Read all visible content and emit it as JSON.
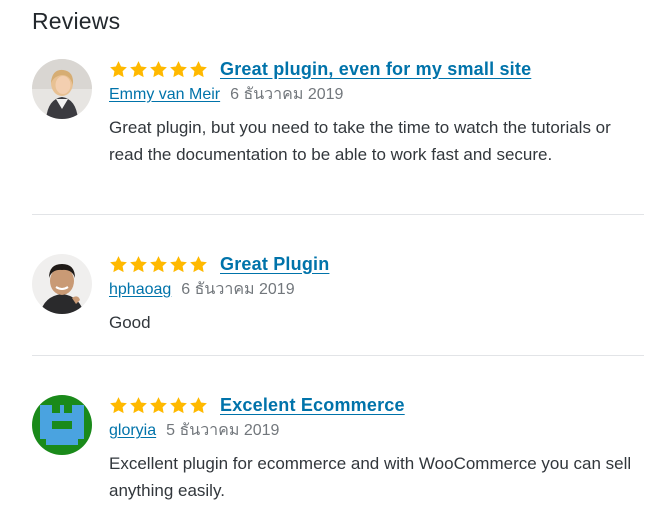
{
  "heading": "Reviews",
  "colors": {
    "link": "#0073aa",
    "star": "#ffb900",
    "date": "#72777c",
    "divider": "#e2e4e7"
  },
  "reviews": [
    {
      "title": "Great plugin, even for my small site",
      "rating": 5,
      "author": "Emmy van Meir",
      "date": "6 ธันวาคม 2019",
      "text": "Great plugin, but you need to take the time to watch the tutorials or read the documentation to be able to work fast and secure."
    },
    {
      "title": "Great Plugin",
      "rating": 5,
      "author": "hphaoag",
      "date": "6 ธันวาคม 2019",
      "text": "Good"
    },
    {
      "title": "Excelent Ecommerce",
      "rating": 5,
      "author": "gloryia",
      "date": "5 ธันวาคม 2019",
      "text": "Excellent plugin for ecommerce and with WooCommerce you can sell anything easily."
    }
  ]
}
